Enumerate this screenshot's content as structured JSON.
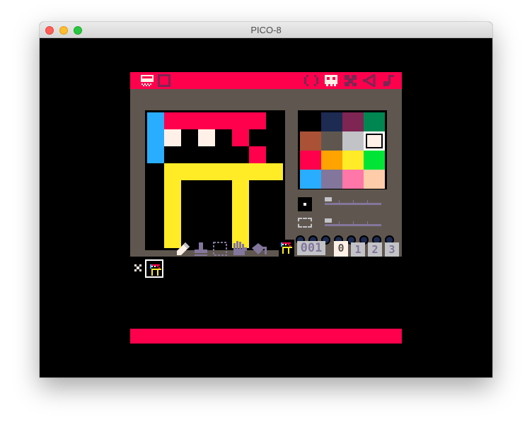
{
  "window": {
    "title": "PICO-8",
    "buttons": [
      "close",
      "minimize",
      "zoom"
    ]
  },
  "editor_tabs": [
    {
      "name": "code-editor",
      "icon": "code-braces-icon"
    },
    {
      "name": "sprite-editor",
      "icon": "sprite-face-icon",
      "active": true
    },
    {
      "name": "map-editor",
      "icon": "map-grid-icon"
    },
    {
      "name": "sfx-editor",
      "icon": "speaker-icon"
    },
    {
      "name": "music-editor",
      "icon": "music-note-icon"
    }
  ],
  "left_controls": [
    {
      "name": "screen-mode",
      "icon": "screen-icon"
    },
    {
      "name": "fullscreen-toggle",
      "icon": "square-outline-icon"
    }
  ],
  "sprite": {
    "number": "001",
    "pixels": [
      "C888888.",
      "C7.7.8..",
      "C.....8.",
      ".AAAAAAA",
      ".A...A..",
      ".A...A..",
      ".A...A..",
      ".A...A.."
    ]
  },
  "palette": {
    "colors": [
      "#000000",
      "#1d2b53",
      "#7e2553",
      "#008751",
      "#ab5236",
      "#5f574f",
      "#c2c3c7",
      "#fff1e8",
      "#ff004d",
      "#ffa300",
      "#ffec27",
      "#00e436",
      "#29adff",
      "#83769c",
      "#ff77a8",
      "#ffccaa"
    ],
    "selected_index": 7
  },
  "pixel_colors": {
    "0": "#000000",
    "7": "#fff1e8",
    "8": "#ff004d",
    "A": "#ffec27",
    "C": "#29adff"
  },
  "brush_size": 1,
  "zoom_level": 1,
  "flags": [
    false,
    false,
    false,
    false,
    false,
    false,
    false,
    false
  ],
  "tools": [
    {
      "name": "pencil",
      "icon": "pencil-icon",
      "active": true
    },
    {
      "name": "stamp",
      "icon": "stamp-icon"
    },
    {
      "name": "select",
      "icon": "dashed-select-icon"
    },
    {
      "name": "pan",
      "icon": "hand-icon"
    },
    {
      "name": "fill",
      "icon": "bucket-icon"
    }
  ],
  "sprite_tabs": [
    "0",
    "1",
    "2",
    "3"
  ],
  "active_sprite_tab": "0",
  "colors": {
    "accent": "#ff004d",
    "panel": "#5f574f",
    "lavender": "#83769c",
    "light": "#c2c3c7",
    "white": "#fff1e8"
  }
}
